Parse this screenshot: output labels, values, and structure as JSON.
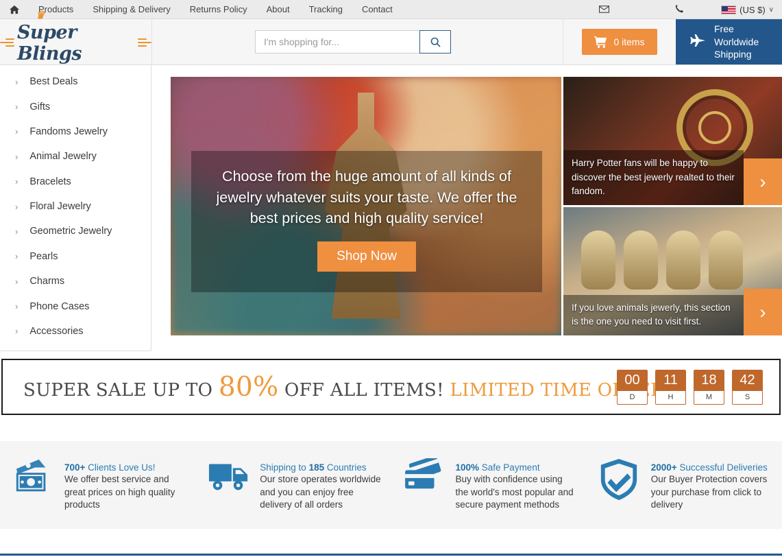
{
  "topbar": {
    "home_icon": "home-icon",
    "nav": [
      {
        "label": "Products"
      },
      {
        "label": "Shipping & Delivery"
      },
      {
        "label": "Returns Policy"
      },
      {
        "label": "About"
      },
      {
        "label": "Tracking"
      },
      {
        "label": "Contact"
      }
    ],
    "mail_icon": "✉",
    "phone_icon": "☎",
    "currency": "(US $)",
    "caret": "∨"
  },
  "header": {
    "logo_text": "Super Blings",
    "crown_icon": "♛",
    "search": {
      "placeholder": "I'm shopping for...",
      "value": "",
      "button_icon": "⚲"
    },
    "cart": {
      "icon": "🛒",
      "label": "0 items"
    },
    "shipping": {
      "icon": "✈",
      "line1": "Free",
      "line2": "Worldwide",
      "line3": "Shipping"
    }
  },
  "sidebar": {
    "chevron": "›",
    "items": [
      {
        "label": "Best Deals"
      },
      {
        "label": "Gifts"
      },
      {
        "label": "Fandoms Jewelry"
      },
      {
        "label": "Animal Jewelry"
      },
      {
        "label": "Bracelets"
      },
      {
        "label": "Floral Jewelry"
      },
      {
        "label": "Geometric Jewelry"
      },
      {
        "label": "Pearls"
      },
      {
        "label": "Charms"
      },
      {
        "label": "Phone Cases"
      },
      {
        "label": "Accessories"
      }
    ]
  },
  "hero": {
    "headline": "Choose from the huge amount of all kinds of jewelry whatever suits your taste. We offer the best prices and high quality service!",
    "cta_label": "Shop Now"
  },
  "promos": [
    {
      "name": "harry-potter-promo",
      "caption": "Harry Potter fans will be happy to discover the best jewerly realted to their fandom.",
      "arrow": "›"
    },
    {
      "name": "animal-jewelry-promo",
      "caption": "If you love animals jewerly, this section is the one you need to visit first.",
      "arrow": "›"
    }
  ],
  "sale": {
    "text_before": "SUPER SALE UP TO ",
    "percent": "80%",
    "text_middle": " OFF ALL ITEMS! ",
    "limited": "LIMITED TIME OFFER",
    "timer": [
      {
        "value": "00",
        "unit": "D"
      },
      {
        "value": "11",
        "unit": "H"
      },
      {
        "value": "18",
        "unit": "M"
      },
      {
        "value": "42",
        "unit": "S"
      }
    ]
  },
  "trust": [
    {
      "icon": "money-icon",
      "highlight": "700+",
      "head_rest": " Clients Love Us!",
      "desc": "We offer best service and great prices on high quality products"
    },
    {
      "icon": "truck-icon",
      "highlight": "185",
      "head_before": "Shipping to ",
      "head_rest": " Countries",
      "desc": "Our store operates worldwide and you can enjoy free delivery of all orders"
    },
    {
      "icon": "credit-cards-icon",
      "highlight": "100%",
      "head_rest": " Safe Payment",
      "desc": "Buy with confidence using the world's most popular and secure payment methods"
    },
    {
      "icon": "shield-check-icon",
      "highlight": "2000+",
      "head_rest": " Successful Deliveries",
      "desc": "Our Buyer Protection covers your purchase from click to delivery"
    }
  ],
  "colors": {
    "accent_orange": "#ef8f40",
    "brand_blue": "#23578c",
    "sale_orange": "#ef9a3d",
    "timer_orange": "#c0672c",
    "trust_blue": "#2b7cb2"
  }
}
